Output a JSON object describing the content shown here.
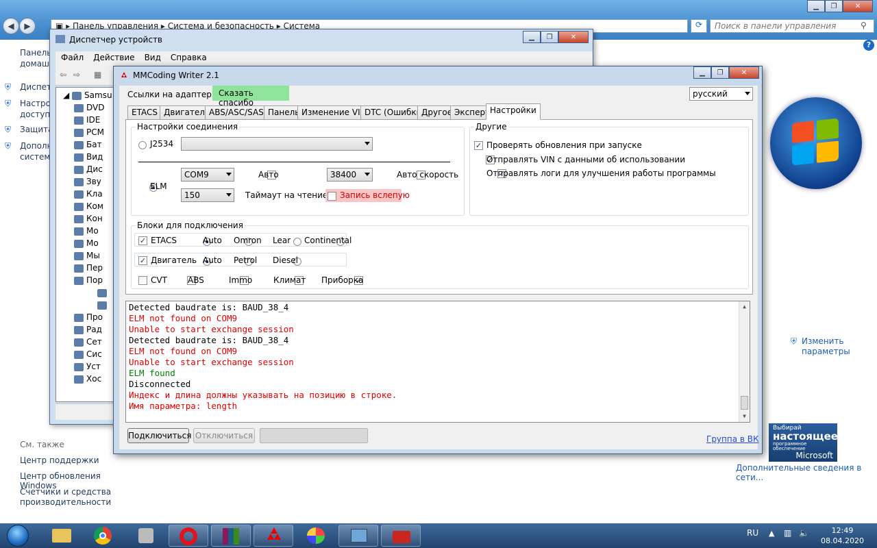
{
  "control_panel": {
    "breadcrumb": [
      "Панель управления",
      "Система и безопасность",
      "Система"
    ],
    "search_placeholder": "Поиск в панели управления",
    "left_links": [
      "Панель управления — домашняя страница",
      "Диспетчер устройств",
      "Настройка удаленного доступа",
      "Защита системы",
      "Дополнительные параметры системы"
    ],
    "left_short": [
      "Панель",
      "домаш",
      "Диспет",
      "Настро",
      "доступа",
      "Защита",
      "Дополн",
      "системы"
    ],
    "see_also_title": "См. также",
    "see_also": [
      "Центр поддержки",
      "Центр обновления Windows",
      "Счетчики и средства",
      "производительности"
    ],
    "change_params": "Изменить параметры",
    "ms_badge": {
      "line1": "Выбирай",
      "line2": "настоящее",
      "line3": "программное обеспечение",
      "line4": "Microsoft"
    },
    "more_info": "Дополнительные сведения в сети..."
  },
  "device_manager": {
    "title": "Диспетчер устройств",
    "menu": [
      "Файл",
      "Действие",
      "Вид",
      "Справка"
    ],
    "root": "Samsu",
    "nodes": [
      "DVD",
      "IDE",
      "PCM",
      "Бат",
      "Вид",
      "Дис",
      "Зву",
      "Кла",
      "Ком",
      "Кон",
      "Мо",
      "Мо",
      "Мы",
      "Пер",
      "Пор",
      "",
      "",
      "Про",
      "Рад",
      "Сет",
      "Сис",
      "Уст",
      "Хос"
    ]
  },
  "mm": {
    "title": "MMCoding Writer 2.1",
    "adapter_links": "Ссылки на адаптеры",
    "thanks": "Сказать спасибо",
    "language": "русский",
    "tabs": [
      "ETACS",
      "Двигатель",
      "ABS/ASC/SAS",
      "Панель",
      "Изменение VIN",
      "DTC (Ошибки)",
      "Другое",
      "Эксперт",
      "Настройки"
    ],
    "conn_group": "Настройки соединения",
    "j2534_label": "J2534",
    "elm_label": "ELM",
    "com_port": "COM9",
    "auto_label": "Авто",
    "baud": "38400",
    "auto_speed_label": "Авто скорость",
    "timeout_value": "150",
    "timeout_label": "Таймаут на чтение, мс",
    "blind_write_label": "Запись вслепую",
    "other_group": "Другие",
    "other_options": [
      "Проверять обновления при запуске",
      "Отправлять VIN с данными об использовании",
      "Отправлять логи для улучшения работы программы"
    ],
    "blocks_group": "Блоки для подключения",
    "etacs_row": {
      "name": "ETACS",
      "options": [
        "Auto",
        "Omron",
        "Lear",
        "Continental"
      ]
    },
    "engine_row": {
      "name": "Двигатель",
      "options": [
        "Auto",
        "Petrol",
        "Diesel"
      ]
    },
    "extra_blocks": [
      "CVT",
      "ABS",
      "Immo",
      "Климат",
      "Приборка"
    ],
    "log": [
      {
        "text": "Detected baudrate is: BAUD_38_4",
        "color": "#000000"
      },
      {
        "text": "ELM not found on COM9",
        "color": "#e00000"
      },
      {
        "text": "Unable to start exchange session",
        "color": "#e00000"
      },
      {
        "text": "Detected baudrate is: BAUD_38_4",
        "color": "#000000"
      },
      {
        "text": "ELM not found on COM9",
        "color": "#e00000"
      },
      {
        "text": "Unable to start exchange session",
        "color": "#e00000"
      },
      {
        "text": "ELM found",
        "color": "#008000"
      },
      {
        "text": "Disconnected",
        "color": "#000000"
      },
      {
        "text": "Индекс и длина должны указывать на позицию в строке.",
        "color": "#e00000"
      },
      {
        "text": "Имя параметра: length",
        "color": "#e00000"
      }
    ],
    "connect_btn": "Подключиться",
    "disconnect_btn": "Отключиться",
    "vk_link": "Группа в ВК"
  },
  "tray": {
    "lang": "RU",
    "time": "12:49",
    "date": "08.04.2020"
  }
}
